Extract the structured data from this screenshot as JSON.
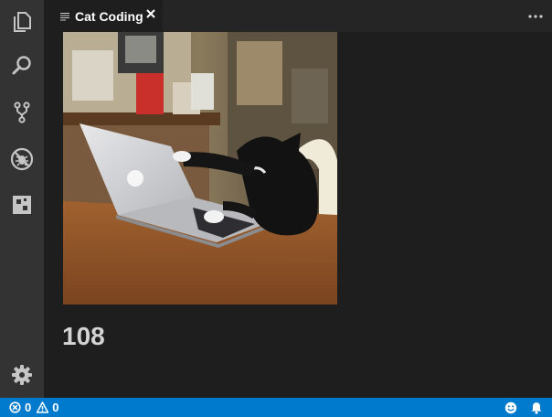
{
  "tab": {
    "title": "Cat Coding",
    "active": true
  },
  "editor": {
    "count": "108"
  },
  "status": {
    "errors": "0",
    "warnings": "0"
  },
  "colors": {
    "statusbar": "#007acc",
    "activitybar": "#333333",
    "editor": "#1e1e1e"
  },
  "icons": {
    "activitybar": [
      "files-icon",
      "search-icon",
      "source-control-icon",
      "debug-icon",
      "extensions-icon",
      "gear-icon"
    ],
    "statusbar_right": [
      "smiley-icon",
      "bell-icon"
    ]
  }
}
